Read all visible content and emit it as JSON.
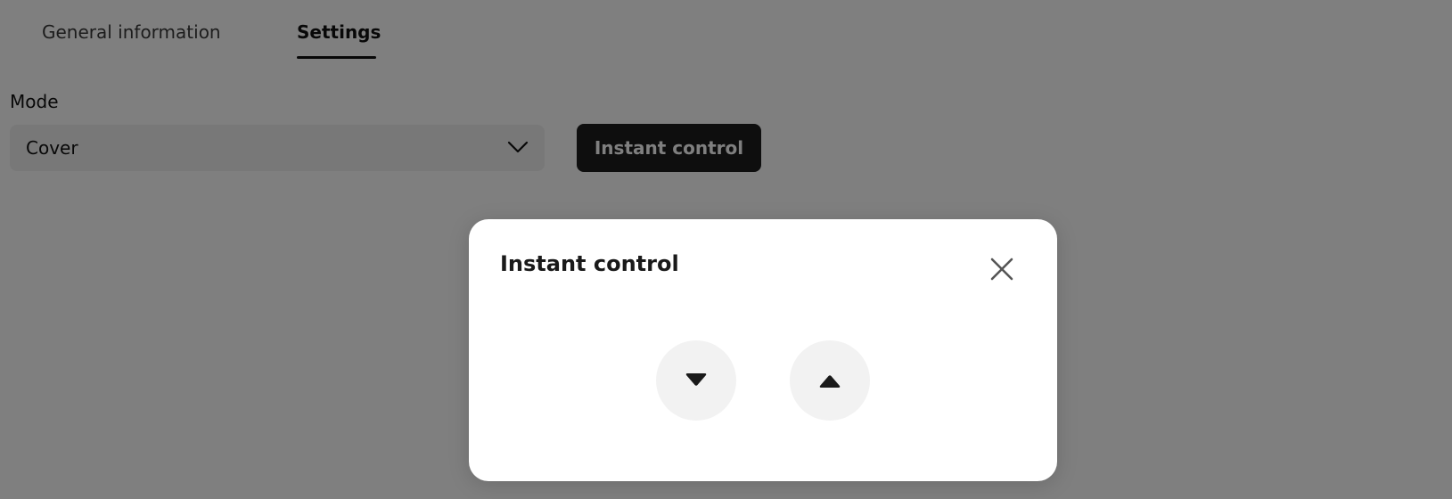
{
  "tabs": {
    "general_label": "General information",
    "settings_label": "Settings",
    "active": "Settings"
  },
  "mode": {
    "label": "Mode",
    "selected_value": "Cover"
  },
  "toolbar": {
    "instant_control_label": "Instant control"
  },
  "modal": {
    "title": "Instant control",
    "close_icon": "close-icon",
    "down_icon": "triangle-down-icon",
    "up_icon": "triangle-up-icon"
  },
  "colors": {
    "overlay": "#000000",
    "primary_button": "#1c1c1c",
    "round_button": "#f2f2f2"
  }
}
